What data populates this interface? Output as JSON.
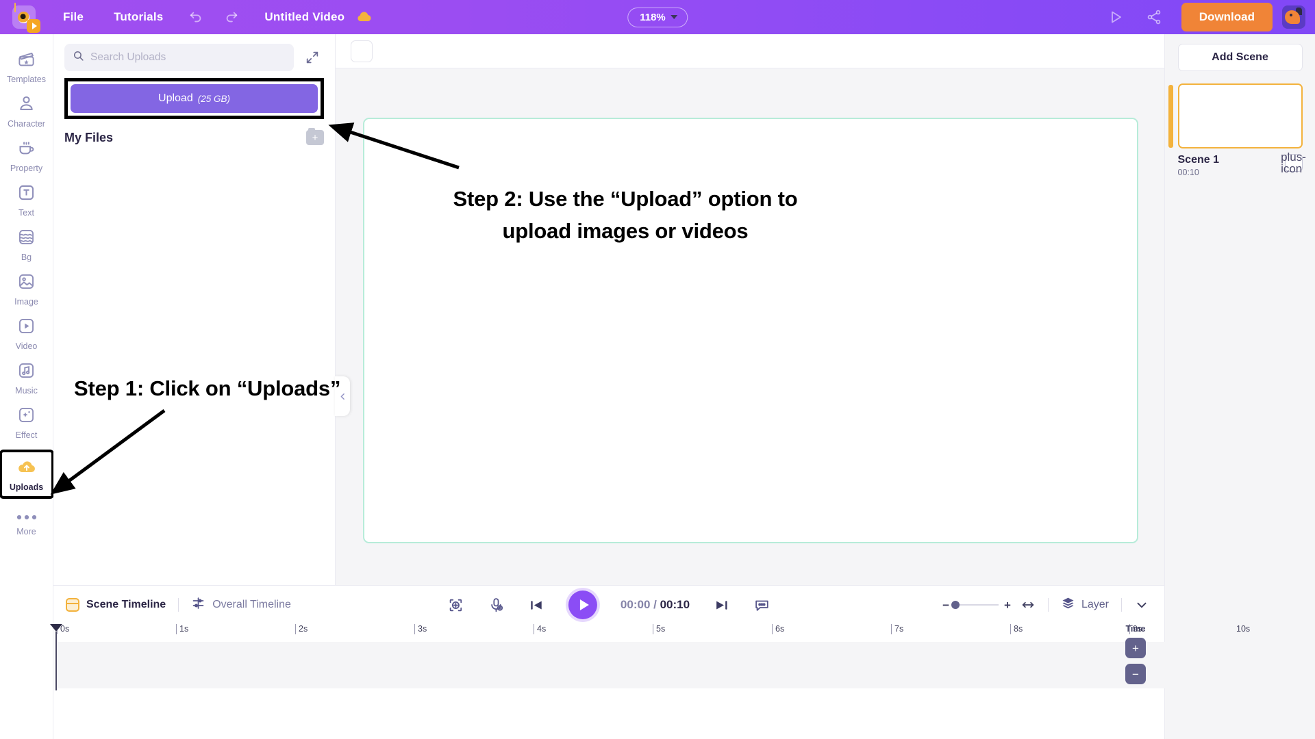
{
  "topbar": {
    "logo_icon": "camera-play-logo",
    "menu": [
      {
        "label": "File",
        "name": "menu-file"
      },
      {
        "label": "Tutorials",
        "name": "menu-tutorials"
      }
    ],
    "undo_icon": "undo-icon",
    "redo_icon": "redo-icon",
    "doc_title": "Untitled Video",
    "cloud_icon": "cloud-saved-icon",
    "zoom_level": "118%",
    "preview_icon": "preview-play-icon",
    "share_icon": "share-icon",
    "download_label": "Download",
    "avatar_icon": "user-avatar"
  },
  "rail": {
    "items": [
      {
        "label": "Templates",
        "icon": "clapperboard-icon",
        "active": false
      },
      {
        "label": "Character",
        "icon": "person-icon",
        "active": false
      },
      {
        "label": "Property",
        "icon": "cup-icon",
        "active": false
      },
      {
        "label": "Text",
        "icon": "text-t-icon",
        "active": false
      },
      {
        "label": "Bg",
        "icon": "layers-icon",
        "active": false
      },
      {
        "label": "Image",
        "icon": "image-icon",
        "active": false
      },
      {
        "label": "Video",
        "icon": "video-play-icon",
        "active": false
      },
      {
        "label": "Music",
        "icon": "music-note-icon",
        "active": false
      },
      {
        "label": "Effect",
        "icon": "sparkle-icon",
        "active": false
      },
      {
        "label": "Uploads",
        "icon": "cloud-upload-icon",
        "active": true
      }
    ],
    "more_label": "More",
    "more_icon": "three-dots-icon"
  },
  "panel": {
    "search_placeholder": "Search Uploads",
    "search_value": "",
    "search_icon": "search-icon",
    "expand_icon": "expand-arrows-icon",
    "upload_label": "Upload",
    "upload_size": "(25 GB)",
    "my_files_title": "My Files",
    "add_folder_icon": "add-folder-icon"
  },
  "canvas": {
    "collapse_icon": "chevron-left-icon",
    "tool_placeholder": "canvas-tool-button"
  },
  "annotations": [
    {
      "id": "anno1",
      "text": "Step 1: Click on “Uploads”"
    },
    {
      "id": "anno2",
      "line1": "Step 2: Use the “Upload” option to",
      "line2": "upload images or videos"
    }
  ],
  "scenes": {
    "add_scene_label": "Add Scene",
    "list": [
      {
        "name": "Scene 1",
        "duration": "00:10",
        "add_icon": "plus-icon"
      }
    ]
  },
  "timeline": {
    "scene_tab": "Scene Timeline",
    "overall_tab": "Overall Timeline",
    "scene_tab_icon": "scene-timeline-icon",
    "overall_tab_icon": "overall-timeline-icon",
    "controls": {
      "fit_icon": "fit-to-frame-icon",
      "mic_icon": "microphone-add-icon",
      "prev_icon": "previous-frame-icon",
      "play_icon": "play-icon",
      "next_icon": "next-frame-icon",
      "caption_icon": "caption-icon",
      "current_time": "00:00",
      "separator": "/",
      "total_time": "00:10"
    },
    "right": {
      "zoom_out_sign": "−",
      "zoom_in_sign": "+",
      "fit_width_icon": "fit-width-icon",
      "layer_label": "Layer",
      "layer_icon": "layers-stack-icon",
      "chevron_icon": "chevron-down-icon"
    },
    "ruler_ticks": [
      "0s",
      "1s",
      "2s",
      "3s",
      "4s",
      "5s",
      "6s",
      "7s",
      "8s",
      "9s",
      "10s"
    ],
    "time_ctl": {
      "label": "Time",
      "plus": "+",
      "minus": "−"
    }
  },
  "colors": {
    "brand_purple": "#8b4df5",
    "accent_orange": "#f08437",
    "upload_purple": "#8366e3",
    "scene_yellow": "#f3b23c",
    "canvas_border": "#b7ecd9"
  }
}
